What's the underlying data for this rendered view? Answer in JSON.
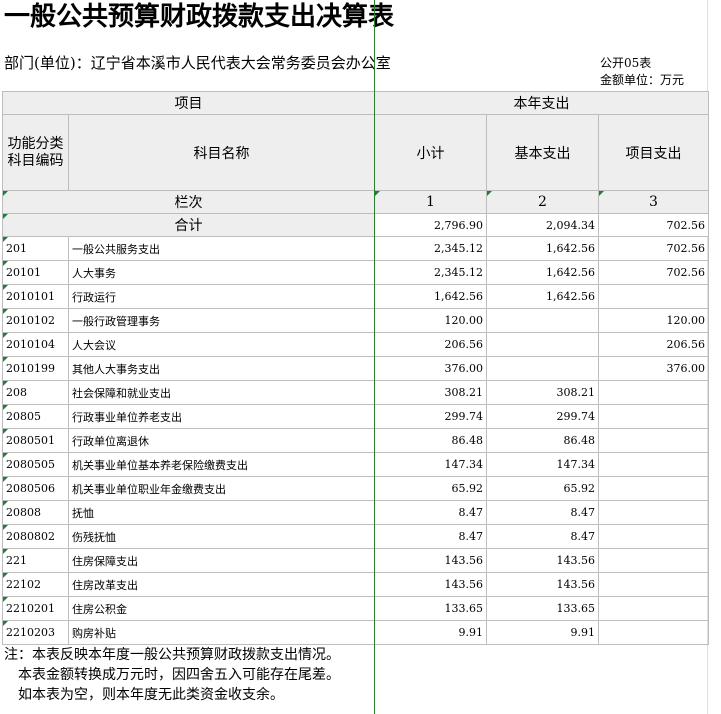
{
  "title": "一般公共预算财政拨款支出决算表",
  "department": "部门(单位)：辽宁省本溪市人民代表大会常务委员会办公室",
  "form_no": "公开05表",
  "unit": "金额单位：万元",
  "headers": {
    "item": "项目",
    "year_expense": "本年支出",
    "func_code": "功能分类科目编码",
    "subject_name": "科目名称",
    "subtotal": "小计",
    "basic": "基本支出",
    "project": "项目支出",
    "column_index": "栏次",
    "col1": "1",
    "col2": "2",
    "col3": "3",
    "total": "合计"
  },
  "total_row": {
    "subtotal": "2,796.90",
    "basic": "2,094.34",
    "project": "702.56"
  },
  "rows": [
    {
      "code": "201",
      "name": "一般公共服务支出",
      "subtotal": "2,345.12",
      "basic": "1,642.56",
      "project": "702.56"
    },
    {
      "code": "20101",
      "name": "人大事务",
      "subtotal": "2,345.12",
      "basic": "1,642.56",
      "project": "702.56"
    },
    {
      "code": "2010101",
      "name": "行政运行",
      "subtotal": "1,642.56",
      "basic": "1,642.56",
      "project": ""
    },
    {
      "code": "2010102",
      "name": "一般行政管理事务",
      "subtotal": "120.00",
      "basic": "",
      "project": "120.00"
    },
    {
      "code": "2010104",
      "name": "人大会议",
      "subtotal": "206.56",
      "basic": "",
      "project": "206.56"
    },
    {
      "code": "2010199",
      "name": "其他人大事务支出",
      "subtotal": "376.00",
      "basic": "",
      "project": "376.00"
    },
    {
      "code": "208",
      "name": "社会保障和就业支出",
      "subtotal": "308.21",
      "basic": "308.21",
      "project": ""
    },
    {
      "code": "20805",
      "name": "行政事业单位养老支出",
      "subtotal": "299.74",
      "basic": "299.74",
      "project": ""
    },
    {
      "code": "2080501",
      "name": "行政单位离退休",
      "subtotal": "86.48",
      "basic": "86.48",
      "project": ""
    },
    {
      "code": "2080505",
      "name": "机关事业单位基本养老保险缴费支出",
      "subtotal": "147.34",
      "basic": "147.34",
      "project": ""
    },
    {
      "code": "2080506",
      "name": "机关事业单位职业年金缴费支出",
      "subtotal": "65.92",
      "basic": "65.92",
      "project": ""
    },
    {
      "code": "20808",
      "name": "抚恤",
      "subtotal": "8.47",
      "basic": "8.47",
      "project": ""
    },
    {
      "code": "2080802",
      "name": "伤残抚恤",
      "subtotal": "8.47",
      "basic": "8.47",
      "project": ""
    },
    {
      "code": "221",
      "name": "住房保障支出",
      "subtotal": "143.56",
      "basic": "143.56",
      "project": ""
    },
    {
      "code": "22102",
      "name": "住房改革支出",
      "subtotal": "143.56",
      "basic": "143.56",
      "project": ""
    },
    {
      "code": "2210201",
      "name": "住房公积金",
      "subtotal": "133.65",
      "basic": "133.65",
      "project": ""
    },
    {
      "code": "2210203",
      "name": "购房补贴",
      "subtotal": "9.91",
      "basic": "9.91",
      "project": ""
    }
  ],
  "notes": [
    "注：本表反映本年度一般公共预算财政拨款支出情况。",
    "本表金额转换成万元时，因四舍五入可能存在尾差。",
    "如本表为空，则本年度无此类资金收支余。"
  ],
  "colors": {
    "gridline": "#bdbdbd",
    "header_bg": "#eeeeee",
    "marker_green": "#1a7f37",
    "selection_line": "#2e7d32"
  }
}
